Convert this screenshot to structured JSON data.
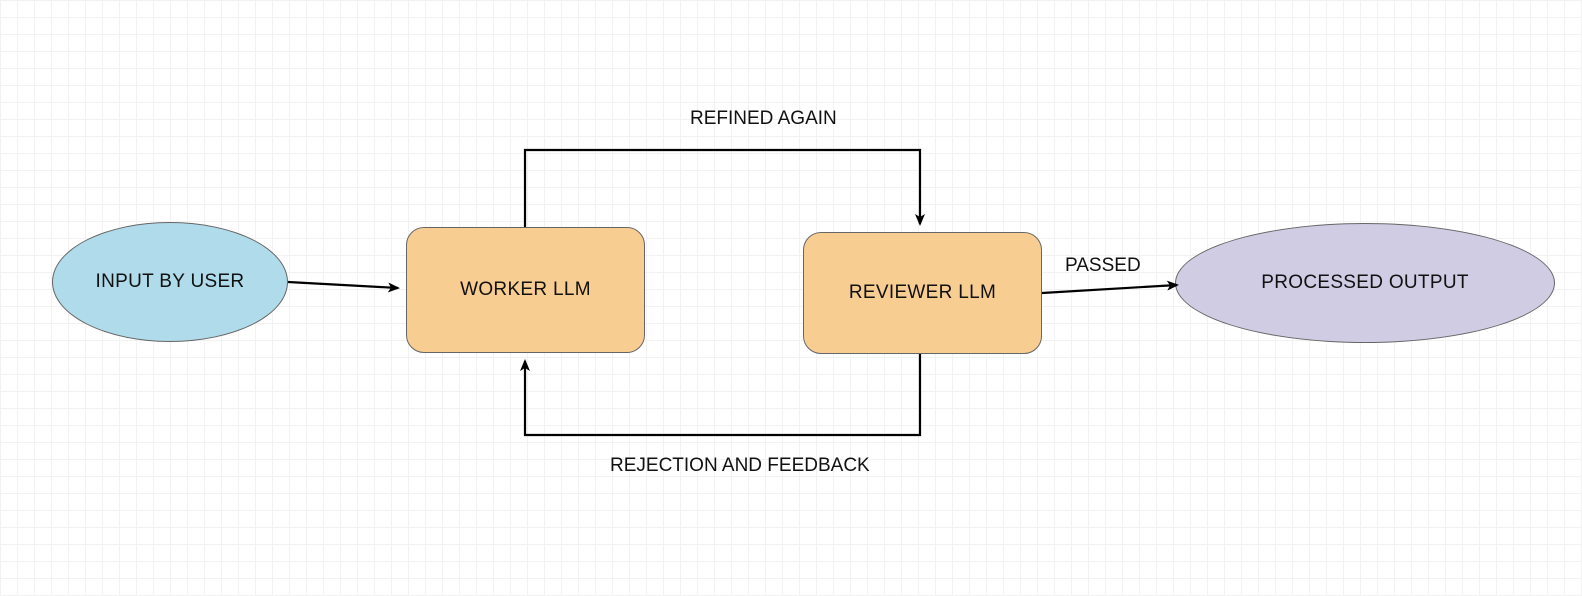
{
  "diagram": {
    "nodes": {
      "input": {
        "label": "INPUT BY USER",
        "shape": "ellipse",
        "fill": "#b0dbeb"
      },
      "worker": {
        "label": "WORKER LLM",
        "shape": "rounded-rect",
        "fill": "#f8cd92"
      },
      "reviewer": {
        "label": "REVIEWER LLM",
        "shape": "rounded-rect",
        "fill": "#f8cd92"
      },
      "output": {
        "label": "PROCESSED OUTPUT",
        "shape": "ellipse",
        "fill": "#cfcce4"
      }
    },
    "edges": {
      "input_to_worker": {
        "from": "input",
        "to": "worker",
        "label": ""
      },
      "worker_to_reviewer_top": {
        "from": "worker",
        "to": "reviewer",
        "label": "REFINED AGAIN"
      },
      "reviewer_to_worker_bottom": {
        "from": "reviewer",
        "to": "worker",
        "label": "REJECTION AND FEEDBACK"
      },
      "reviewer_to_output": {
        "from": "reviewer",
        "to": "output",
        "label": "PASSED"
      }
    }
  }
}
